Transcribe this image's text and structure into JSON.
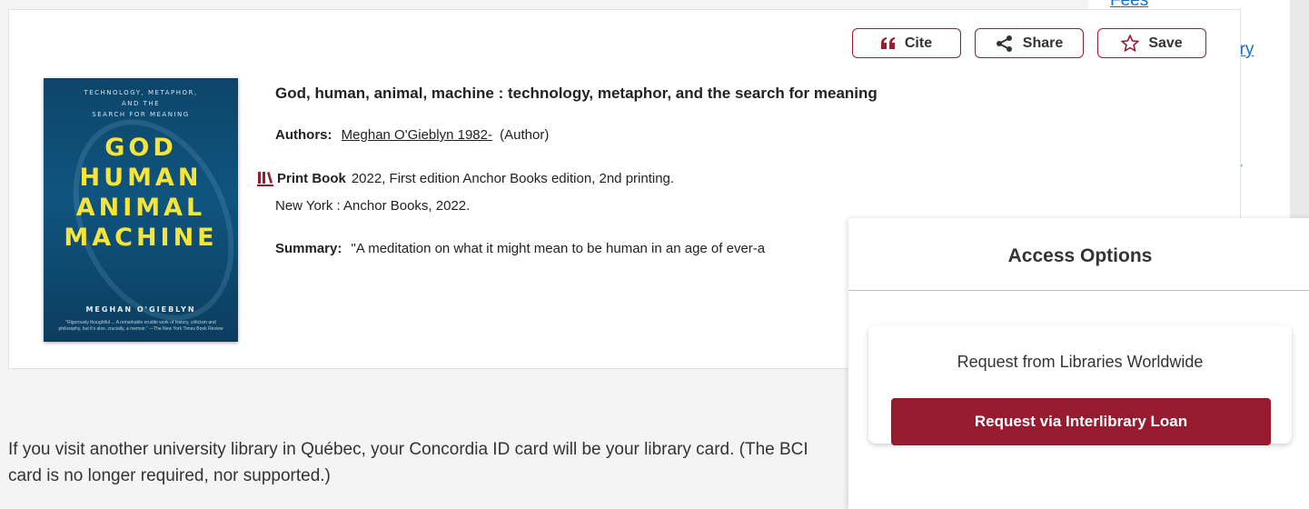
{
  "sidebar": {
    "links": [
      "Fees",
      "ory"
    ],
    "fragment": "ĩ"
  },
  "record": {
    "cover": {
      "subtitle_lines": [
        "TECHNOLOGY, METAPHOR,",
        "AND THE",
        "SEARCH FOR MEANING"
      ],
      "title_lines": [
        "GOD",
        "HUMAN",
        "ANIMAL",
        "MACHINE"
      ],
      "author": "MEGHAN O'GIEBLYN",
      "quote": "\"Rigorously thoughtful ... A remarkable erudite work of history, criticism and philosophy, but it's also, crucially, a memoir.\" —The New York Times Book Review"
    },
    "actions": {
      "cite": "Cite",
      "share": "Share",
      "save": "Save"
    },
    "title": "God, human, animal, machine : technology, metaphor, and the search for meaning",
    "authors_label": "Authors:",
    "author_name": "Meghan O'Gieblyn 1982-",
    "author_role": "(Author)",
    "format": "Print Book",
    "edition": "2022, First edition Anchor Books edition, 2nd printing.",
    "publisher": "New York : Anchor Books, 2022.",
    "summary_label": "Summary:",
    "summary": "\"A meditation on what it might mean to be human in an age of ever-a"
  },
  "info_text": "If you visit another university library in Québec, your Concordia ID card will be your library card. (The BCI card is no longer required, nor supported.)",
  "access": {
    "title": "Access Options",
    "card_label": "Request from Libraries Worldwide",
    "button": "Request via Interlibrary Loan"
  },
  "colors": {
    "accent": "#9b1c2e",
    "link": "#1a6dc0",
    "cover": "#0f557f",
    "cover_title": "#f6e43a"
  },
  "icons": [
    "quote-icon",
    "share-icon",
    "star-icon",
    "print-book-icon"
  ]
}
